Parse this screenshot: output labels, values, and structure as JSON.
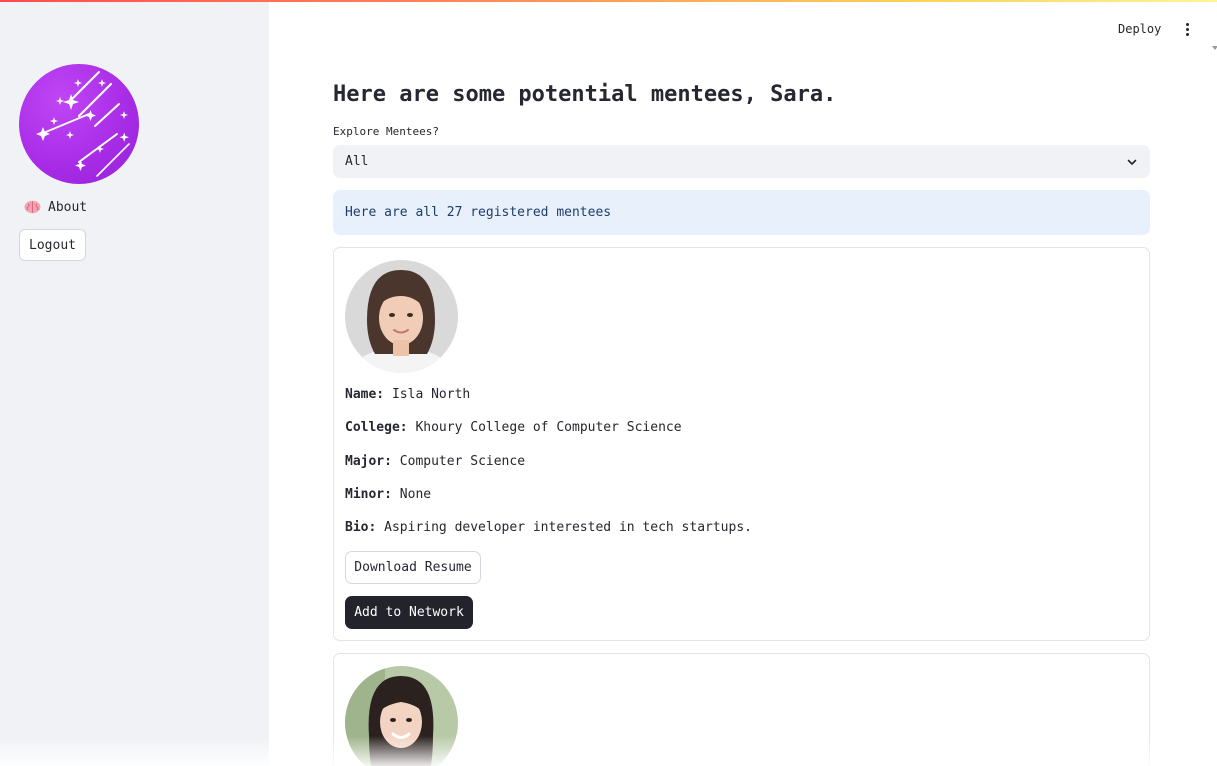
{
  "header": {
    "deploy_label": "Deploy",
    "menu_icon": "kebab-menu-icon"
  },
  "sidebar": {
    "logo_icon": "shooting-stars-logo",
    "nav": [
      {
        "label": "About",
        "icon": "brain-icon"
      }
    ],
    "logout_label": "Logout"
  },
  "main": {
    "title": "Here are some potential mentees, Sara.",
    "select": {
      "label": "Explore Mentees?",
      "value": "All"
    },
    "info": "Here are all 27 registered mentees",
    "cards": [
      {
        "fields": [
          {
            "key": "Name:",
            "value": "Isla North"
          },
          {
            "key": "College:",
            "value": "Khoury College of Computer Science"
          },
          {
            "key": "Major:",
            "value": "Computer Science"
          },
          {
            "key": "Minor:",
            "value": "None"
          },
          {
            "key": "Bio:",
            "value": "Aspiring developer interested in tech startups."
          }
        ],
        "download_label": "Download Resume",
        "add_label": "Add to Network"
      }
    ]
  },
  "colors": {
    "accent_purple": "#a72be6",
    "sidebar_bg": "#f0f2f6",
    "info_bg": "#e8f0fb",
    "primary_button": "#23232b"
  }
}
